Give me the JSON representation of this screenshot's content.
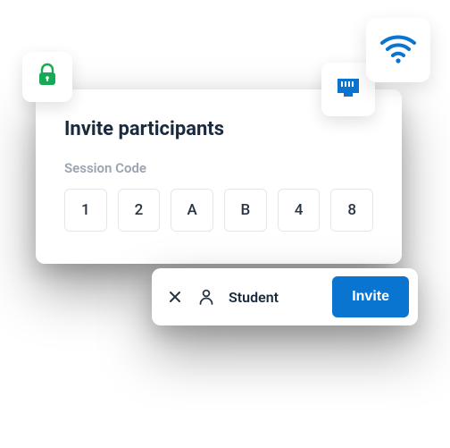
{
  "invite": {
    "title": "Invite participants",
    "session_label": "Session Code",
    "code": [
      "1",
      "2",
      "A",
      "B",
      "4",
      "8"
    ]
  },
  "bar": {
    "role": "Student",
    "invite_label": "Invite"
  },
  "icons": {
    "lock": "lock-icon",
    "wifi": "wifi-icon",
    "ethernet": "ethernet-icon",
    "close": "close-icon",
    "person": "person-icon"
  },
  "colors": {
    "accent": "#0a74d1",
    "lock_green": "#18a957",
    "wifi_blue": "#0a74d1",
    "eth_blue": "#0a74d1"
  }
}
